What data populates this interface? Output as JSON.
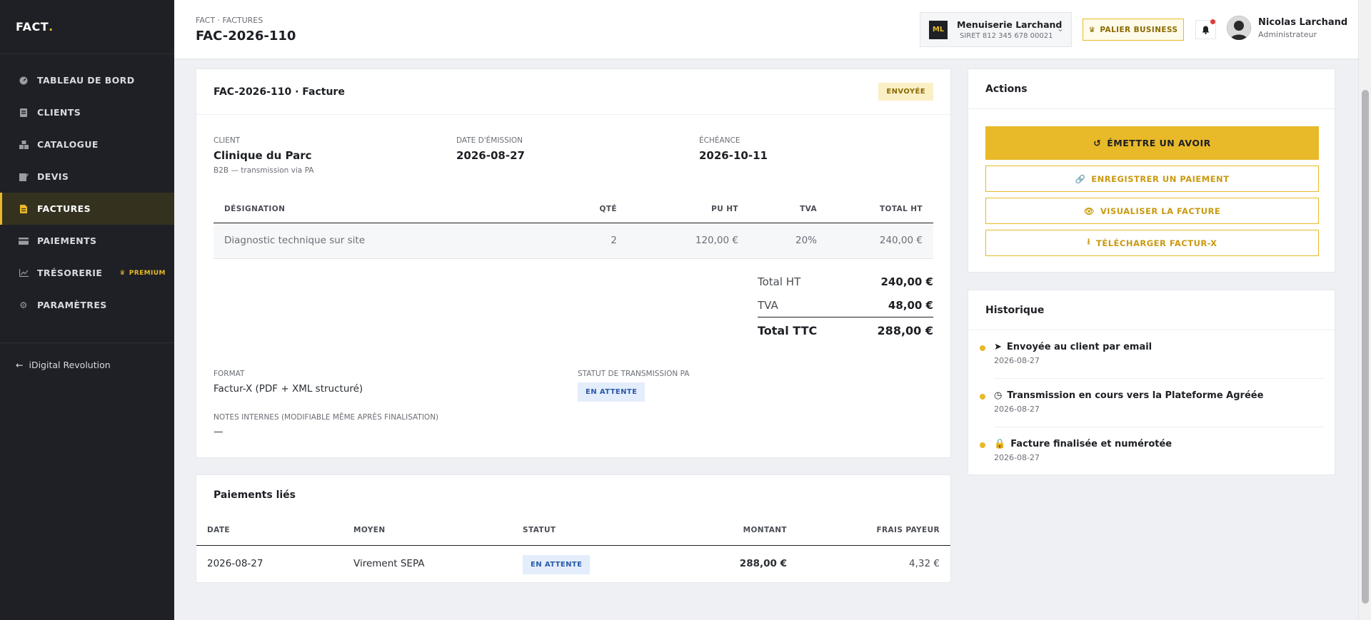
{
  "app": {
    "logo": "FACT",
    "logo_dot": "."
  },
  "sidebar": {
    "items": [
      {
        "label": "TABLEAU DE BORD",
        "icon": "dashboard-icon"
      },
      {
        "label": "CLIENTS",
        "icon": "clients-icon"
      },
      {
        "label": "CATALOGUE",
        "icon": "catalogue-icon"
      },
      {
        "label": "DEVIS",
        "icon": "quote-icon"
      },
      {
        "label": "FACTURES",
        "icon": "invoice-icon",
        "active": true
      },
      {
        "label": "PAIEMENTS",
        "icon": "card-icon"
      },
      {
        "label": "TRÉSORERIE",
        "icon": "chart-icon",
        "badge": "PREMIUM"
      },
      {
        "label": "PARAMÈTRES",
        "icon": "gear-icon"
      }
    ],
    "back_label": "iDigital Revolution"
  },
  "header": {
    "breadcrumb": "FACT · FACTURES",
    "title": "FAC-2026-110",
    "org": {
      "initials": "ML",
      "name": "Menuiserie Larchand",
      "siret": "SIRET 812 345 678 00021"
    },
    "plan_label": "PALIER BUSINESS",
    "user": {
      "name": "Nicolas Larchand",
      "role": "Administrateur"
    }
  },
  "invoice": {
    "title": "FAC-2026-110 · Facture",
    "status": "ENVOYÉE",
    "client_label": "CLIENT",
    "client": "Clinique du Parc",
    "client_sub": "B2B — transmission via PA",
    "issue_label": "DATE D'ÉMISSION",
    "issue_date": "2026-08-27",
    "due_label": "ÉCHÉANCE",
    "due_date": "2026-10-11",
    "columns": [
      "DÉSIGNATION",
      "QTÉ",
      "PU HT",
      "TVA",
      "TOTAL HT"
    ],
    "lines": [
      {
        "designation": "Diagnostic technique sur site",
        "qty": "2",
        "pu": "120,00 €",
        "tva": "20%",
        "total": "240,00 €"
      }
    ],
    "totals": {
      "ht_label": "Total HT",
      "ht": "240,00 €",
      "tva_label": "TVA",
      "tva": "48,00 €",
      "ttc_label": "Total TTC",
      "ttc": "288,00 €"
    },
    "format_label": "FORMAT",
    "format": "Factur-X (PDF + XML structuré)",
    "pa_label": "STATUT DE TRANSMISSION PA",
    "pa_status": "EN ATTENTE",
    "notes_label": "NOTES INTERNES (MODIFIABLE MÊME APRÈS FINALISATION)",
    "notes": "—"
  },
  "payments": {
    "title": "Paiements liés",
    "columns": [
      "DATE",
      "MOYEN",
      "STATUT",
      "MONTANT",
      "FRAIS PAYEUR"
    ],
    "rows": [
      {
        "date": "2026-08-27",
        "method": "Virement SEPA",
        "status": "EN ATTENTE",
        "amount": "288,00 €",
        "fee": "4,32 €"
      }
    ]
  },
  "actions": {
    "title": "Actions",
    "credit_note": "ÉMETTRE UN AVOIR",
    "record_payment": "ENREGISTRER UN PAIEMENT",
    "view_invoice": "VISUALISER LA FACTURE",
    "download": "TÉLÉCHARGER FACTUR-X"
  },
  "history": {
    "title": "Historique",
    "items": [
      {
        "text": "Envoyée au client par email",
        "date": "2026-08-27",
        "icon": "send-icon"
      },
      {
        "text": "Transmission en cours vers la Plateforme Agréée",
        "date": "2026-08-27",
        "icon": "clock-icon"
      },
      {
        "text": "Facture finalisée et numérotée",
        "date": "2026-08-27",
        "icon": "lock-icon"
      }
    ]
  },
  "colors": {
    "accent": "#e8b928",
    "sidebar": "#1e2025",
    "pending": "#e3edfb"
  }
}
